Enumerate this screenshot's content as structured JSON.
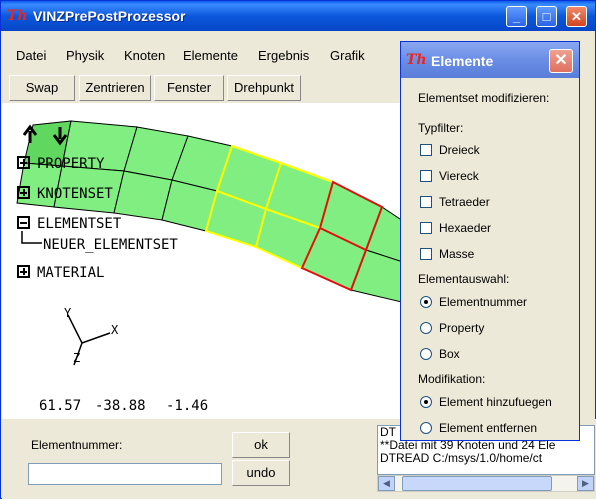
{
  "window": {
    "title": "VINZPrePostProzessor",
    "logo": "Th",
    "minimize": "_",
    "maximize": "□",
    "close": "✕"
  },
  "menu": [
    "Datei",
    "Physik",
    "Knoten",
    "Elemente",
    "Ergebnis",
    "Grafik"
  ],
  "toolbar": [
    "Swap",
    "Zentrieren",
    "Fenster",
    "Drehpunkt"
  ],
  "tree": {
    "items": [
      "PROPERTY",
      "KNOTENSET",
      "ELEMENTSET",
      "NEUER_ELEMENTSET",
      "MATERIAL"
    ]
  },
  "axes": {
    "x": "X",
    "y": "Y",
    "z": "Z"
  },
  "coords": {
    "x": "61.57",
    "y": "-38.88",
    "z": "-1.46"
  },
  "input": {
    "label": "Elementnummer:",
    "value": ""
  },
  "buttons": {
    "ok": "ok",
    "undo": "undo"
  },
  "log": [
    "DT",
    "**Datei mit 39 Knoten und 24 Ele",
    "DTREAD C:/msys/1.0/home/ct"
  ],
  "dialog": {
    "title": "Elemente",
    "logo": "Th",
    "close": "✕",
    "heading": "Elementset modifizieren:",
    "typfilter_label": "Typfilter:",
    "typfilter": [
      "Dreieck",
      "Viereck",
      "Tetraeder",
      "Hexaeder",
      "Masse"
    ],
    "auswahl_label": "Elementauswahl:",
    "auswahl": [
      "Elementnummer",
      "Property",
      "Box"
    ],
    "auswahl_selected": "Elementnummer",
    "modifikation_label": "Modifikation:",
    "modifikation": [
      "Element hinzufuegen",
      "Element entfernen"
    ],
    "modifikation_selected": "Element hinzufuegen"
  },
  "colors": {
    "mesh_fill": "#80ee80",
    "mesh_line": "#000000",
    "selection_yellow": "#ffff00",
    "selection_red": "#e01010"
  }
}
